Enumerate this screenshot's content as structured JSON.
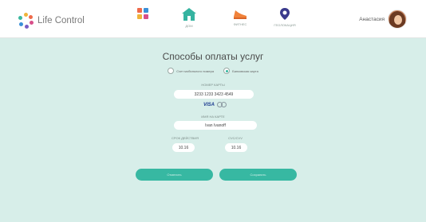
{
  "header": {
    "brand": "Life Control",
    "nav": [
      {
        "label": "",
        "icon": "apps-grid-icon"
      },
      {
        "label": "ДОМ",
        "icon": "home-icon"
      },
      {
        "label": "ФИТНЕС",
        "icon": "sneaker-icon"
      },
      {
        "label": "ГЕОЛОКАЦИЯ",
        "icon": "location-pin-icon"
      }
    ],
    "user_name": "Анастасия"
  },
  "payment": {
    "title": "Способы оплаты услуг",
    "options": [
      {
        "label": "Счет мобильного номера",
        "checked": false
      },
      {
        "label": "Банковская карта",
        "checked": true
      }
    ],
    "card_number_label": "НОМЕР КАРТЫ",
    "card_number": "3233 1233 3423 4549",
    "card_brands": [
      "VISA",
      "mastercard"
    ],
    "card_holder_label": "ИМЯ НА КАРТЕ",
    "card_holder": "Ivan Ivanoff",
    "expiry_label": "СРОК ДЕЙСТВИЯ",
    "expiry": "10.16",
    "cvc_label": "CVC/CVV",
    "cvc": "10.16",
    "cancel_label": "Отменить",
    "save_label": "Сохранить"
  },
  "colors": {
    "accent": "#37b8a2",
    "panel": "#d7eee9",
    "nav_orange": "#f0823a",
    "nav_purple": "#3a3a8c"
  }
}
